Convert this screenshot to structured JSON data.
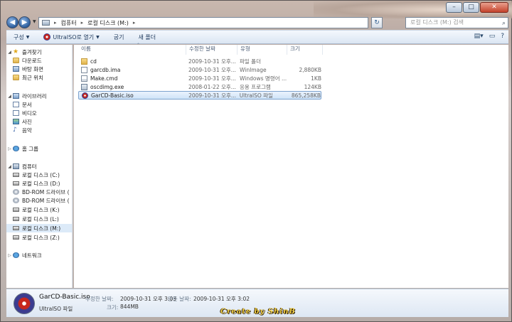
{
  "window": {
    "controls": {
      "minimize": "–",
      "maximize": "□",
      "close": "✕"
    }
  },
  "nav": {
    "back": "◀",
    "forward": "▶",
    "breadcrumb": [
      "컴퓨터",
      "로컬 디스크 (M:)"
    ],
    "search_placeholder": "로컬 디스크 (M:) 검색"
  },
  "toolbar": {
    "organize": "구성",
    "open_with": "UltraISO로 열기",
    "burn": "굽기",
    "new_folder": "새 폴더"
  },
  "sidebar": {
    "favorites": {
      "label": "즐겨찾기",
      "items": [
        "다운로드",
        "바탕 화면",
        "최근 위치"
      ]
    },
    "libraries": {
      "label": "라이브러리",
      "items": [
        "문서",
        "비디오",
        "사진",
        "음악"
      ]
    },
    "homegroup": "홈 그룹",
    "computer": {
      "label": "컴퓨터",
      "items": [
        "로컬 디스크 (C:)",
        "로컬 디스크 (D:)",
        "BD-ROM 드라이브 (",
        "BD-ROM 드라이브 (",
        "로컬 디스크 (K:)",
        "로컬 디스크 (L:)",
        "로컬 디스크 (M:)",
        "로컬 디스크 (Z:)"
      ]
    },
    "network": "네트워크"
  },
  "columns": {
    "name": "이름",
    "date": "수정한 날짜",
    "type": "유형",
    "size": "크기"
  },
  "files": [
    {
      "name": "cd",
      "date": "2009-10-31 오후...",
      "type": "파일 폴더",
      "size": "",
      "icon": "folder-icon"
    },
    {
      "name": "garcdb.ima",
      "date": "2009-10-31 오후...",
      "type": "WinImage",
      "size": "2,880KB",
      "icon": "file-icon"
    },
    {
      "name": "Make.cmd",
      "date": "2009-10-31 오후...",
      "type": "Windows 명령어 ...",
      "size": "1KB",
      "icon": "cmd-icon"
    },
    {
      "name": "oscdimg.exe",
      "date": "2008-01-22 오후...",
      "type": "응용 프로그램",
      "size": "124KB",
      "icon": "exe-icon"
    },
    {
      "name": "GarCD-Basic.iso",
      "date": "2009-10-31 오후...",
      "type": "UltraISO 파일",
      "size": "865,258KB",
      "icon": "iso-icon"
    }
  ],
  "details": {
    "file_name": "GarCD-Basic.iso",
    "file_type": "UltraISO 파일",
    "modified_label": "수정한 날짜:",
    "modified_value": "2009-10-31 오후 3:03",
    "created_label": "만든 날짜:",
    "created_value": "2009-10-31 오후 3:02",
    "size_label": "크기:",
    "size_value": "844MB"
  },
  "watermark": "Create by ShinB"
}
